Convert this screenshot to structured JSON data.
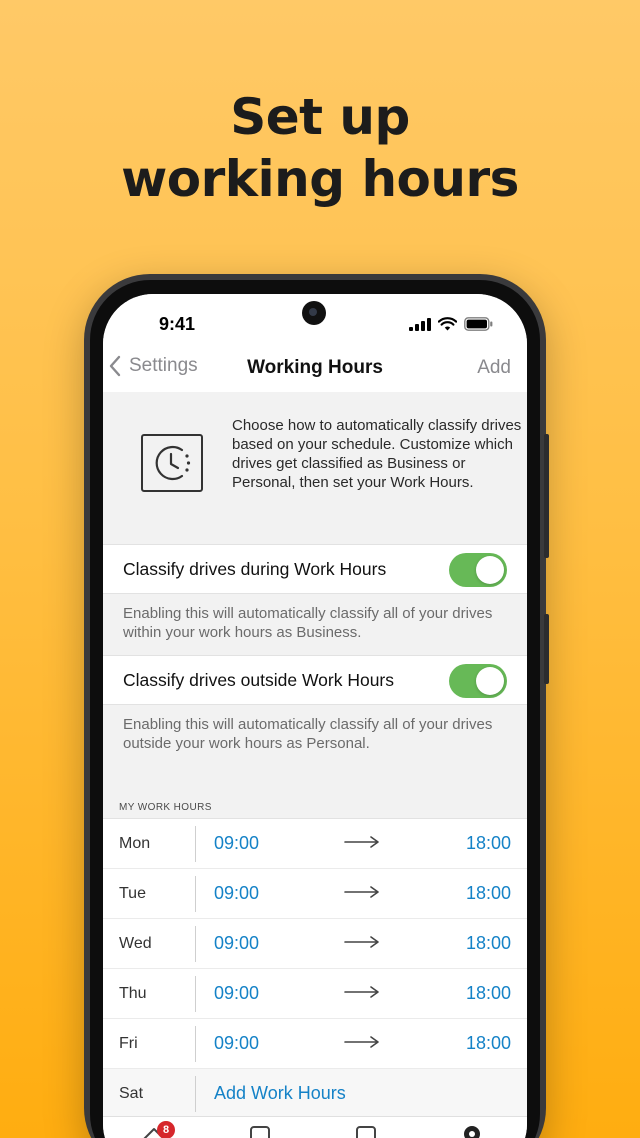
{
  "headline": {
    "line1": "Set up",
    "line2": "working hours"
  },
  "status_bar": {
    "time": "9:41"
  },
  "nav": {
    "back_label": "Settings",
    "title": "Working Hours",
    "add_label": "Add"
  },
  "intro": {
    "icon": "clock-icon",
    "text": "Choose how to automatically classify drives based on your schedule. Customize which drives get classified as Business or Personal, then set your Work Hours."
  },
  "classify_during": {
    "label": "Classify drives during Work Hours",
    "enabled": true,
    "hint": "Enabling this will automatically classify all of your drives within your work hours as Business."
  },
  "classify_outside": {
    "label": "Classify drives outside Work Hours",
    "enabled": true,
    "hint": "Enabling this will automatically classify all of your drives outside your work hours as Personal."
  },
  "work_hours": {
    "section_label": "MY WORK HOURS",
    "days": [
      {
        "day": "Mon",
        "start": "09:00",
        "end": "18:00"
      },
      {
        "day": "Tue",
        "start": "09:00",
        "end": "18:00"
      },
      {
        "day": "Wed",
        "start": "09:00",
        "end": "18:00"
      },
      {
        "day": "Thu",
        "start": "09:00",
        "end": "18:00"
      },
      {
        "day": "Fri",
        "start": "09:00",
        "end": "18:00"
      },
      {
        "day": "Sat",
        "add_label": "Add Work Hours"
      }
    ]
  },
  "tab_bar": {
    "badge_count": "8"
  },
  "colors": {
    "accent_blue": "#1582c7",
    "toggle_on": "#67b957",
    "badge_red": "#d6262b"
  }
}
